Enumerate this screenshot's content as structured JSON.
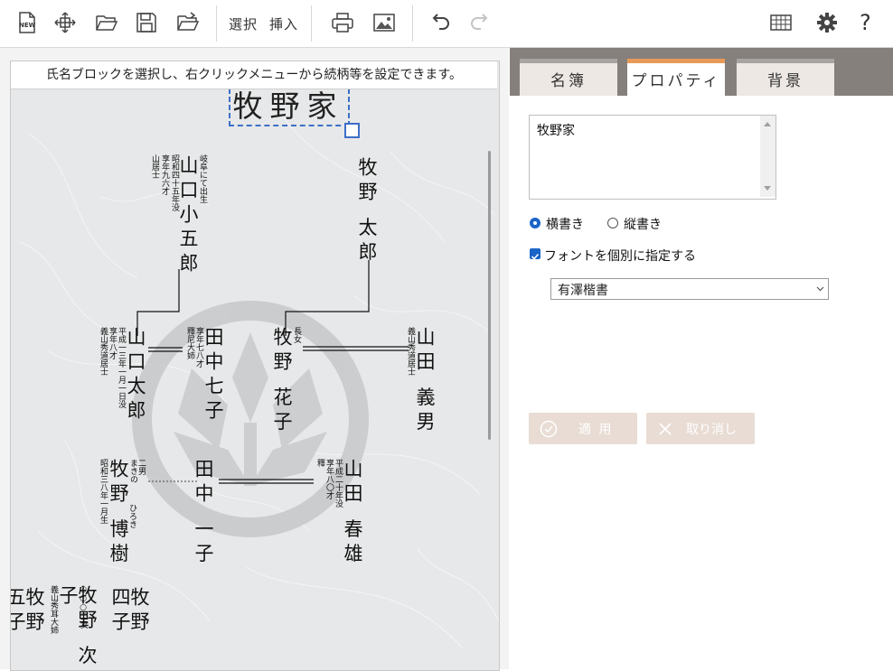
{
  "toolbar": {
    "select_label": "選択",
    "insert_label": "挿入",
    "help_label": "?"
  },
  "canvas": {
    "hint": "氏名ブロックを選択し、右クリックメニューから続柄等を設定できます。",
    "family_title": "牧野家",
    "persons": [
      {
        "name": "山口小五郎",
        "note": "岐阜にて出生",
        "note2": "昭和四十五年没",
        "note3": "享年九六才",
        "note4": "山居士"
      },
      {
        "name": "牧野 太郎"
      },
      {
        "name": "山口太郎",
        "note": "平成一三年一月一日没",
        "note2": "享年八才",
        "note3": "義山秀道居士"
      },
      {
        "name": "田中七子",
        "note": "享年七八才",
        "note2": "釋尼大姉"
      },
      {
        "name": "牧野 花子",
        "note": "長女"
      },
      {
        "name": "山田 義男",
        "note": "義山秀道居士"
      },
      {
        "name": "牧野 博樹",
        "note": "二男",
        "note2": "まきの",
        "note3": "昭和三八年一月生",
        "ruby": "ひろき"
      },
      {
        "name": "田中 一子"
      },
      {
        "name": "山田 春雄",
        "note": "平成二十年没",
        "note2": "享年八〇才",
        "note3": "釋"
      },
      {
        "name": "牧野 五子"
      },
      {
        "name": "牧野 次子",
        "note": "○○○二女",
        "note2": "義山秀耳大姉"
      },
      {
        "name": "牧野 四子"
      }
    ]
  },
  "panel": {
    "tabs": [
      {
        "label": "名簿"
      },
      {
        "label": "プロパティ"
      },
      {
        "label": "背景"
      }
    ],
    "text_value": "牧野家",
    "radio_horizontal": "横書き",
    "radio_vertical": "縦書き",
    "checkbox_label": "フォントを個別に指定する",
    "font_value": "有澤楷書",
    "apply_label": "適 用",
    "cancel_label": "取り消し"
  },
  "colors": {
    "tab_active_accent": "#e79a58",
    "tabbar_bg": "#86807c",
    "selection_blue": "#3e6fc7",
    "button_bg": "#e8dcd4"
  }
}
